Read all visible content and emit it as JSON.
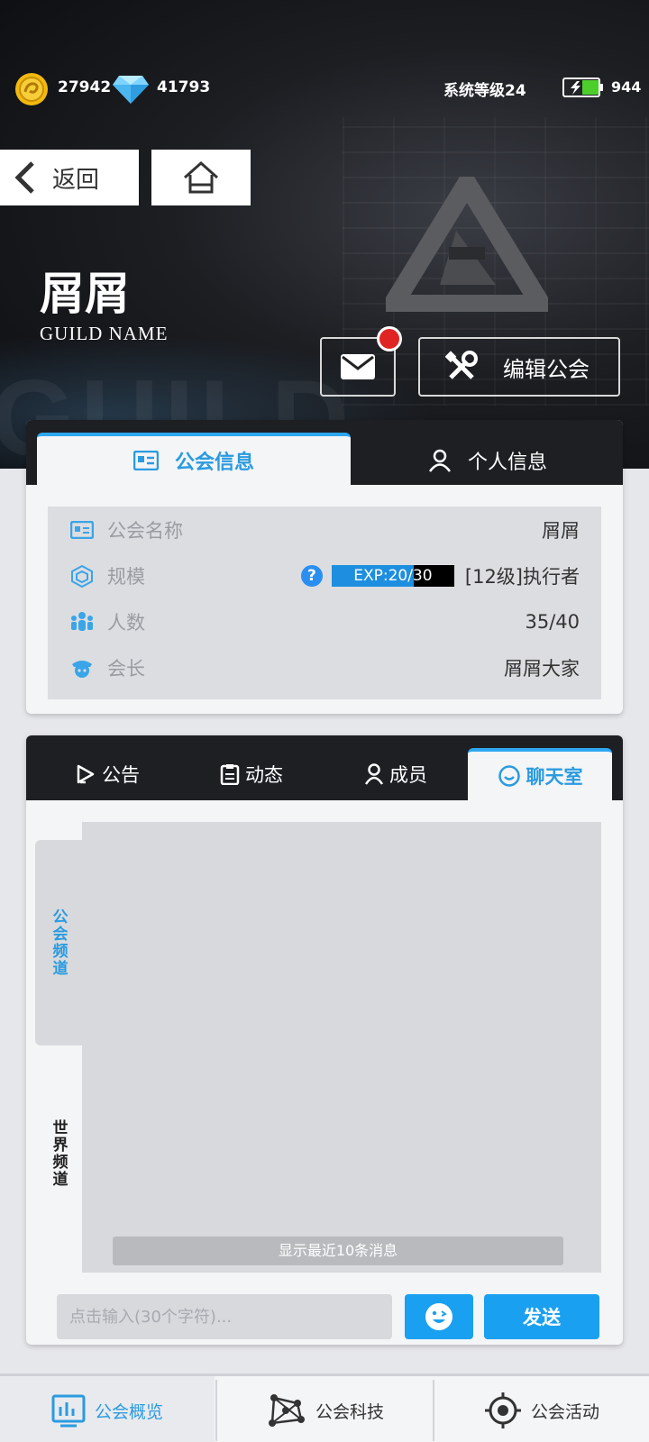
{
  "status": {
    "coins": "27942",
    "gems": "41793",
    "level": "系统等级24",
    "energy": "944"
  },
  "nav": {
    "back_label": "返回"
  },
  "guild": {
    "name": "屑屑",
    "subtitle": "GUILD NAME",
    "edit_label": "编辑公会",
    "mail_has_unread": true
  },
  "info_tabs": {
    "guild_info": "公会信息",
    "personal_info": "个人信息"
  },
  "info_rows": {
    "name_label": "公会名称",
    "name_value": "屑屑",
    "scale_label": "规模",
    "exp_text": "EXP:20/30",
    "exp_fraction": 0.667,
    "scale_value": "[12级]执行者",
    "members_label": "人数",
    "members_value": "35/40",
    "leader_label": "会长",
    "leader_value": "屑屑大家"
  },
  "chat_tabs": {
    "announce": "公告",
    "dynamics": "动态",
    "members": "成员",
    "chatroom": "聊天室"
  },
  "chat": {
    "guild_channel": "公会频道",
    "world_channel": "世界频道",
    "notice": "显示最近10条消息",
    "input_placeholder": "点击输入(30个字符)...",
    "send_label": "发送"
  },
  "bottom_nav": {
    "overview": "公会概览",
    "tech": "公会科技",
    "activity": "公会活动"
  },
  "colors": {
    "accent": "#2a9be0",
    "button": "#1aa0f0",
    "badge": "#e02424"
  }
}
